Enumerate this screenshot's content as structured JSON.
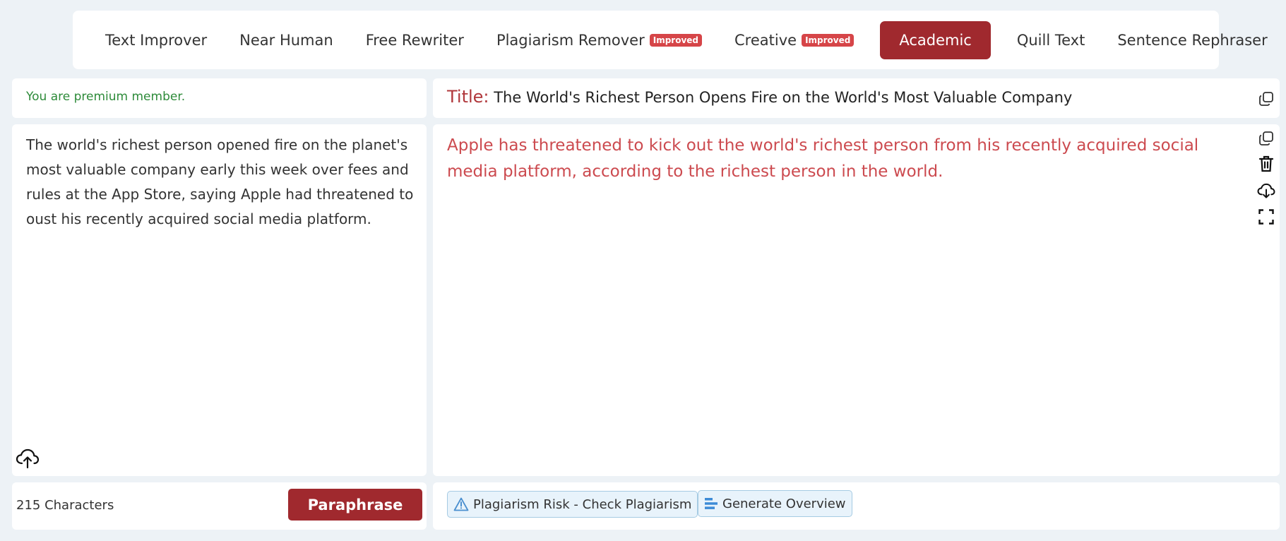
{
  "tabs": [
    {
      "label": "Text Improver",
      "badge": ""
    },
    {
      "label": "Near Human",
      "badge": ""
    },
    {
      "label": "Free Rewriter",
      "badge": ""
    },
    {
      "label": "Plagiarism Remover",
      "badge": "Improved"
    },
    {
      "label": "Creative",
      "badge": "Improved"
    },
    {
      "label": "Academic",
      "badge": ""
    },
    {
      "label": "Quill Text",
      "badge": ""
    },
    {
      "label": "Sentence Rephraser",
      "badge": ""
    }
  ],
  "active_tab": "Academic",
  "member_status": "You are premium member.",
  "title": {
    "label": "Title:",
    "text": "The World's Richest Person Opens Fire on the World's Most Valuable Company"
  },
  "input_text": "The world's richest person opened fire on the planet's most valuable company early this week over fees and rules at the App Store, saying Apple had threatened to oust his recently acquired social media platform.",
  "output_text": "Apple has threatened to kick out the world's richest person from his recently acquired social media platform, according to the richest person in the world.",
  "char_count": "215 Characters",
  "paraphrase_label": "Paraphrase",
  "actions": {
    "plagiarism_label": "Plagiarism Risk - Check Plagiarism",
    "overview_label": "Generate Overview"
  },
  "icons": [
    "copy-icon",
    "trash-icon",
    "cloud-download-icon",
    "fullscreen-icon",
    "cloud-upload-icon",
    "warning-icon",
    "overview-icon"
  ],
  "colors": {
    "accent": "#a0292e",
    "badge": "#d64548",
    "output_text": "#cc4a4f",
    "member_text": "#2e8b3a",
    "chip_bg": "#e8f3fb"
  }
}
